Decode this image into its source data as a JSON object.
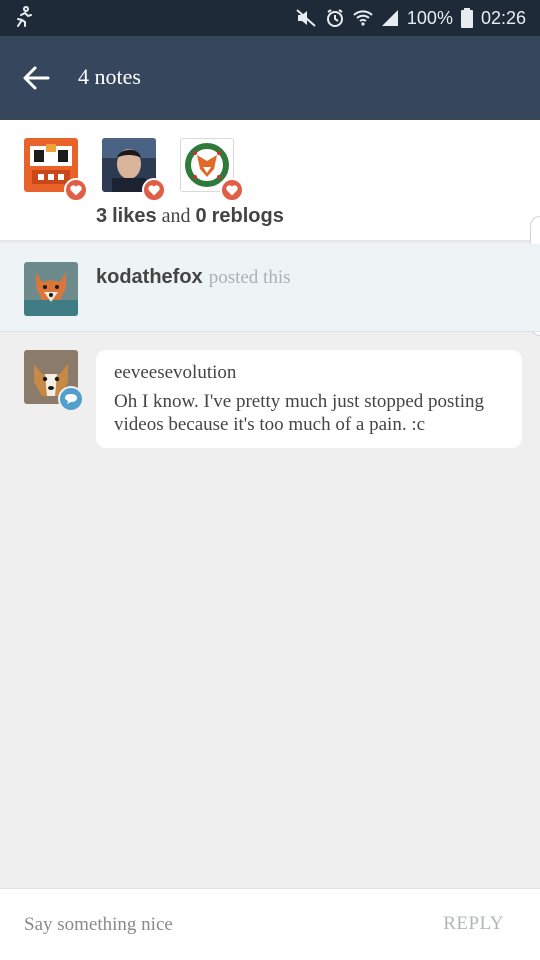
{
  "status_bar": {
    "battery": "100%",
    "time": "02:26",
    "icons": [
      "runner-icon",
      "mute-icon",
      "alarm-icon",
      "wifi-icon",
      "signal-icon",
      "battery-icon"
    ]
  },
  "header": {
    "title": "4 notes",
    "back_icon": "back-arrow-icon"
  },
  "likes": {
    "avatars": [
      {
        "name": "avatar-orange-robot",
        "badge": "heart-icon"
      },
      {
        "name": "avatar-man-portrait",
        "badge": "heart-icon"
      },
      {
        "name": "avatar-fox-wreath",
        "badge": "heart-icon"
      }
    ],
    "likes_count": "3",
    "likes_word": "likes",
    "and_word": "and",
    "reblogs_count": "0",
    "reblogs_word": "reblogs"
  },
  "posted": {
    "username": "kodathefox",
    "action": "posted this"
  },
  "reply": {
    "username": "eeveesevolution",
    "text": "Oh I know. I've pretty much just stopped posting videos because it's too much of a pain. :c",
    "badge": "chat-bubble-icon"
  },
  "composer": {
    "placeholder": "Say something nice",
    "reply_label": "REPLY"
  },
  "colors": {
    "status_bar": "#1e2a38",
    "header": "#36465d",
    "heart": "#e05e46",
    "chat_badge": "#529ecc",
    "posted_bg": "#eef3f6",
    "page_bg": "#efefef"
  }
}
